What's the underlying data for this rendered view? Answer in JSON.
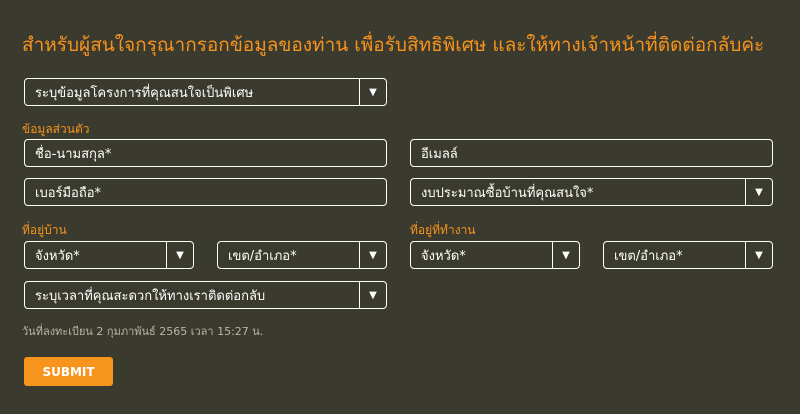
{
  "header": {
    "title": "สำหรับผู้สนใจกรุณากรอกข้อมูลของท่าน เพื่อรับสิทธิพิเศษ และให้ทางเจ้าหน้าที่ติดต่อกลับค่ะ"
  },
  "form": {
    "project_select": "ระบุข้อมูลโครงการที่คุณสนใจเป็นพิเศษ",
    "personal_label": "ข้อมูลส่วนตัว",
    "name": "ชื่อ-นามสกุล*",
    "email": "อีเมลล์",
    "phone": "เบอร์มือถือ*",
    "budget": "งบประมาณซื้อบ้านที่คุณสนใจ*",
    "home_label": "ที่อยู่บ้าน",
    "home_province": "จังหวัด*",
    "home_district": "เขต/อำเภอ*",
    "work_label": "ที่อยู่ที่ทำงาน",
    "work_province": "จังหวัด*",
    "work_district": "เขต/อำเภอ*",
    "contact_time": "ระบุเวลาที่คุณสะดวกให้ทางเราติดต่อกลับ",
    "note": "วันที่ลงทะเบียน 2 กุมภาพันธ์ 2565 เวลา 15:27 น.",
    "submit": "SUBMIT"
  },
  "icons": {
    "dropdown": "▼"
  },
  "colors": {
    "accent": "#f7941d",
    "background": "#3b3a2e"
  }
}
